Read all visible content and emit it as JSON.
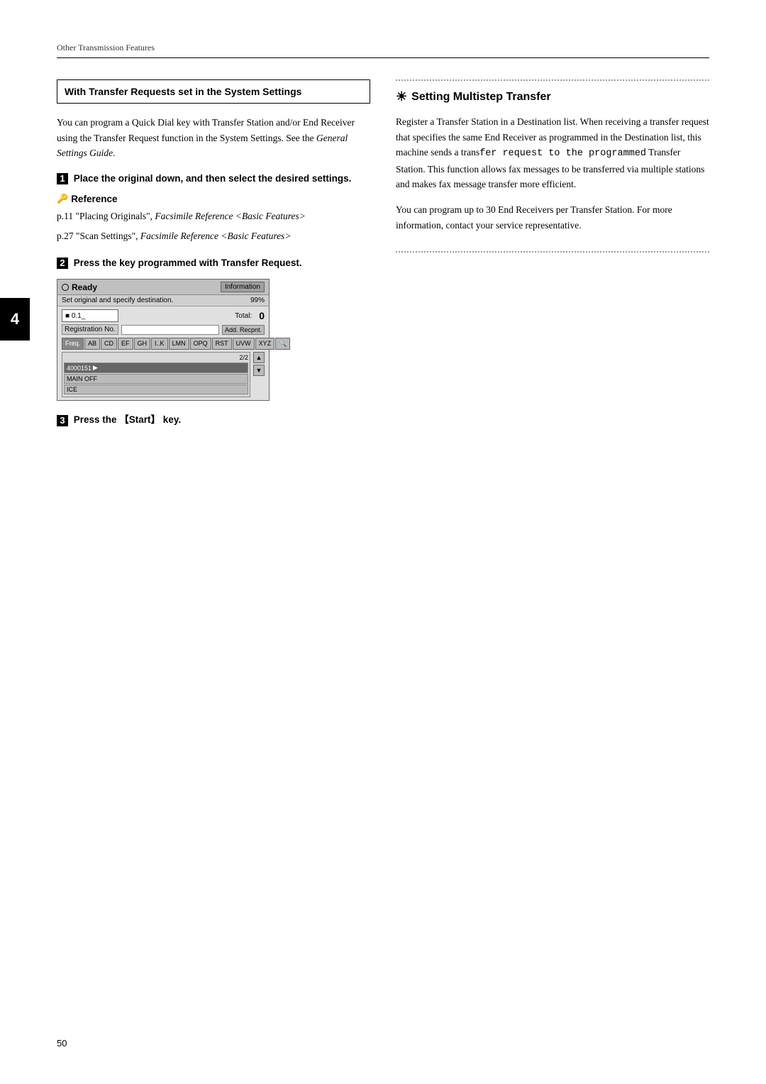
{
  "header": {
    "breadcrumb": "Other Transmission Features"
  },
  "chapter_tab": "4",
  "left_col": {
    "section_box_title": "With Transfer Requests set in the System Settings",
    "intro_text": "You can program a Quick Dial key with Transfer Station and/or End Receiver using the Transfer Request function in the System Settings. See the General Settings Guide.",
    "intro_italic": "General Settings Guide",
    "step1": {
      "number": "1",
      "text": "Place the original down, and then select the desired settings."
    },
    "reference": {
      "title": "Reference",
      "item1_text": "p.11 “Placing Originals”, Facsimile Reference <Basic Features>",
      "item1_italic": "Facsimile Reference <Basic Features>",
      "item2_text": "p.27 “Scan Settings”, Facsimile Reference <Basic Features>",
      "item2_italic": "Facsimile Reference <Basic Features>"
    },
    "step2": {
      "number": "2",
      "text": "Press the key programmed with Transfer Request."
    },
    "screen": {
      "ready_label": "Ready",
      "info_btn": "Information",
      "subtitle": "Set original and specify destination.",
      "memory_icon": "99%",
      "total_label": "Total:",
      "total_value": "0",
      "reg_label": "Registration No.",
      "add_btn": "Add. Recpnt.",
      "tabs": [
        "Freq.",
        "AB",
        "CD",
        "EF",
        "GH",
        "IJK",
        "LMN",
        "OPQ",
        "RST",
        "UVW",
        "XYZ",
        "search"
      ],
      "page_num": "2/2",
      "list_items": [
        {
          "label": "4000151",
          "arrow": "►",
          "selected": true
        },
        {
          "label": "MAIN OFF",
          "selected": false
        },
        {
          "label": "ICE",
          "selected": false
        }
      ],
      "scroll_up": "▲",
      "scroll_down": "▼"
    },
    "step3": {
      "number": "3",
      "text": "Press the 【Start】 key."
    }
  },
  "right_col": {
    "section_title": "Setting Multistep Transfer",
    "sun_icon": "☀",
    "para1": "Register a Transfer Station in a Destination list. When receiving a transfer request that specifies the same End Receiver as programmed in the Destination list, this machine sends a transfer request to the programmed Transfer Station. This function allows fax messages to be transferred via multiple stations and makes fax message transfer more efficient.",
    "para1_mono": "fer request to the programmed",
    "para2": "You can program up to 30 End Receivers per Transfer Station. For more information, contact your service representative."
  },
  "page_number": "50"
}
